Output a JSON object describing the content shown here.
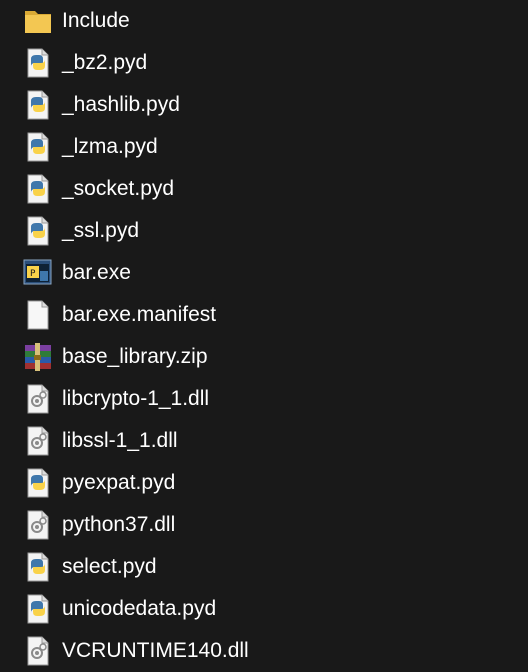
{
  "explorer": {
    "files": [
      {
        "name": "Include",
        "icon": "folder-icon"
      },
      {
        "name": "_bz2.pyd",
        "icon": "python-file-icon"
      },
      {
        "name": "_hashlib.pyd",
        "icon": "python-file-icon"
      },
      {
        "name": "_lzma.pyd",
        "icon": "python-file-icon"
      },
      {
        "name": "_socket.pyd",
        "icon": "python-file-icon"
      },
      {
        "name": "_ssl.pyd",
        "icon": "python-file-icon"
      },
      {
        "name": "bar.exe",
        "icon": "exe-icon"
      },
      {
        "name": "bar.exe.manifest",
        "icon": "blank-file-icon"
      },
      {
        "name": "base_library.zip",
        "icon": "zip-archive-icon"
      },
      {
        "name": "libcrypto-1_1.dll",
        "icon": "dll-file-icon"
      },
      {
        "name": "libssl-1_1.dll",
        "icon": "dll-file-icon"
      },
      {
        "name": "pyexpat.pyd",
        "icon": "python-file-icon"
      },
      {
        "name": "python37.dll",
        "icon": "dll-file-icon"
      },
      {
        "name": "select.pyd",
        "icon": "python-file-icon"
      },
      {
        "name": "unicodedata.pyd",
        "icon": "python-file-icon"
      },
      {
        "name": "VCRUNTIME140.dll",
        "icon": "dll-file-icon"
      }
    ],
    "colors": {
      "background": "#191919",
      "text": "#ffffff",
      "folder": "#f3c752",
      "python_blue": "#3f77ab",
      "python_yellow": "#f9d24a"
    }
  }
}
